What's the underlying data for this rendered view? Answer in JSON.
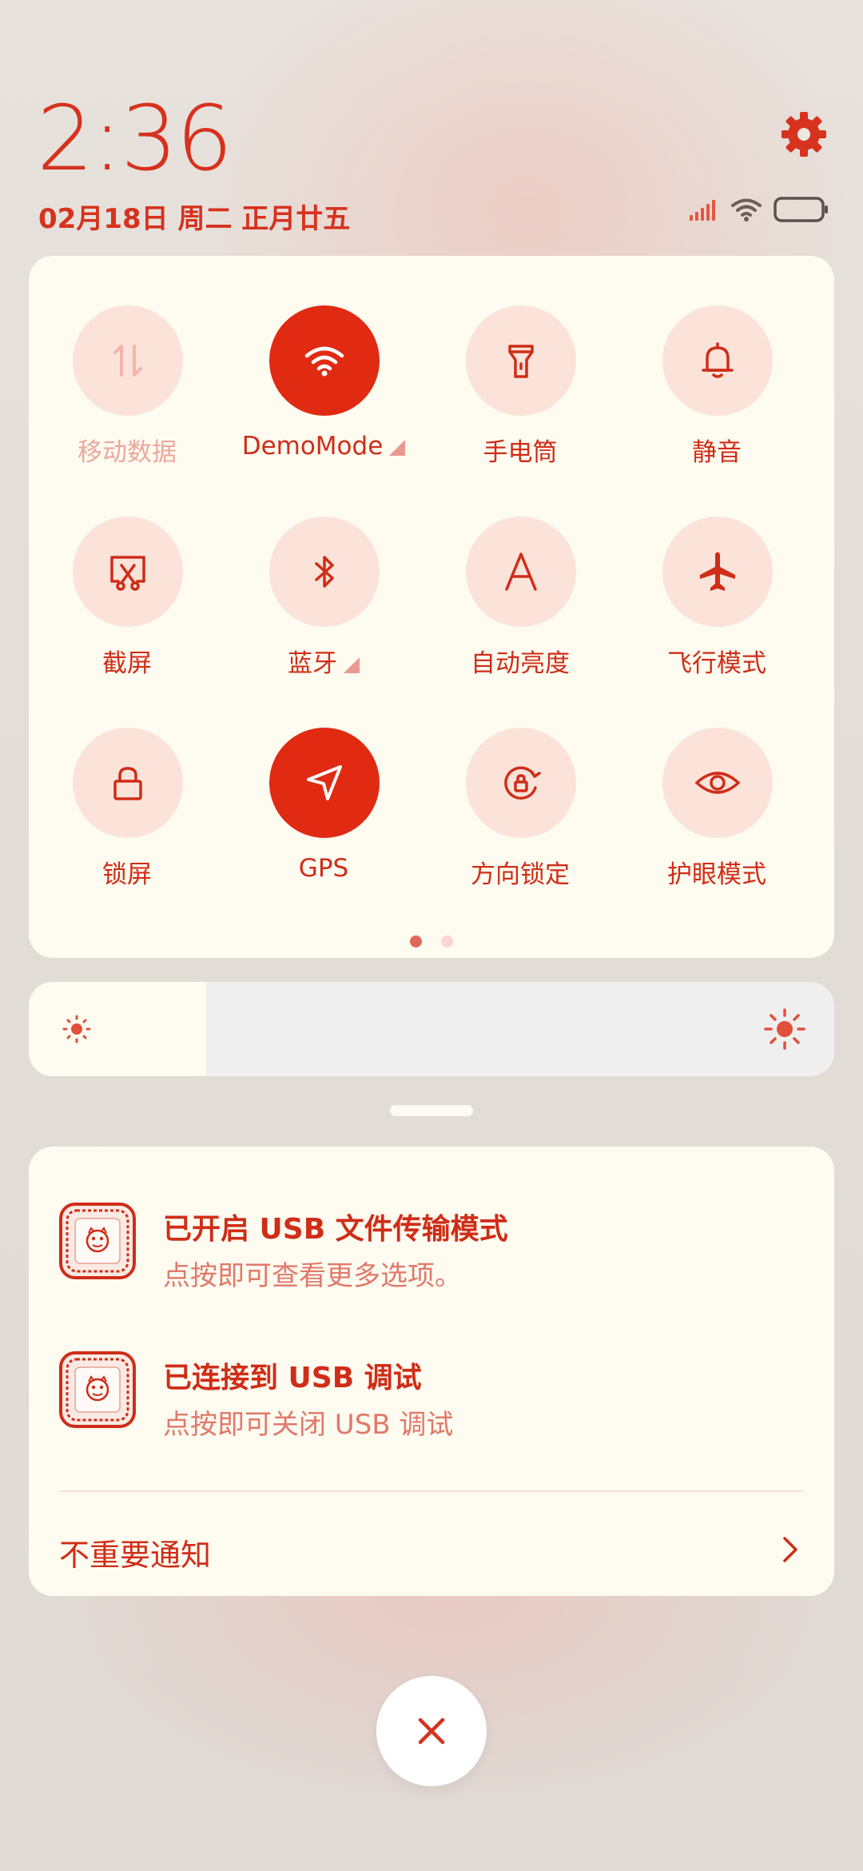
{
  "status_bar": {
    "time": "2:36",
    "date": "02月18日 周二 正月廿五"
  },
  "icons": [
    "gear-icon",
    "signal-icon",
    "wifi-icon",
    "battery-icon",
    "close-icon",
    "chevron-right-icon"
  ],
  "colors": {
    "accent": "#e02a12",
    "text": "#cf2d18",
    "panel": "#fefbf0",
    "tile_off": "#fbe3da"
  },
  "tiles": [
    {
      "label": "移动数据",
      "icon": "mobile-data-icon",
      "state": "disabled"
    },
    {
      "label": "DemoMode",
      "icon": "wifi-icon",
      "state": "on"
    },
    {
      "label": "手电筒",
      "icon": "flashlight-icon",
      "state": "off"
    },
    {
      "label": "静音",
      "icon": "bell-icon",
      "state": "off"
    },
    {
      "label": "截屏",
      "icon": "screenshot-icon",
      "state": "off"
    },
    {
      "label": "蓝牙",
      "icon": "bluetooth-icon",
      "state": "off"
    },
    {
      "label": "自动亮度",
      "icon": "auto-brightness-icon",
      "state": "off"
    },
    {
      "label": "飞行模式",
      "icon": "airplane-icon",
      "state": "off"
    },
    {
      "label": "锁屏",
      "icon": "lock-icon",
      "state": "off"
    },
    {
      "label": "GPS",
      "icon": "location-arrow-icon",
      "state": "on"
    },
    {
      "label": "方向锁定",
      "icon": "rotation-lock-icon",
      "state": "off"
    },
    {
      "label": "护眼模式",
      "icon": "eye-icon",
      "state": "off"
    }
  ],
  "pager": {
    "current_page": 1,
    "total_pages": 2
  },
  "brightness": {
    "level": 0.22
  },
  "notifications": [
    {
      "title": "已开启 USB 文件传输模式",
      "text": "点按即可查看更多选项。"
    },
    {
      "title": "已连接到 USB 调试",
      "text": "点按即可关闭 USB 调试"
    }
  ],
  "minor_notifications": {
    "label": "不重要通知"
  }
}
